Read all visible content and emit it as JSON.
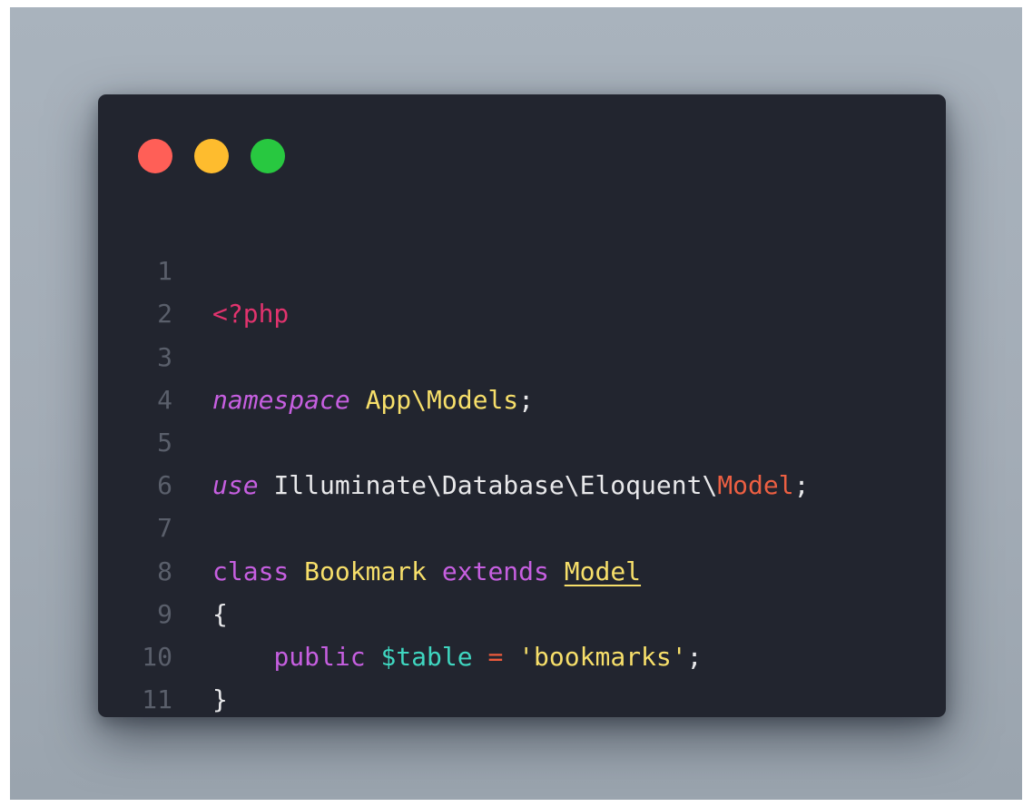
{
  "window": {
    "controls": {
      "close_color": "#ff5f57",
      "minimize_color": "#febc2e",
      "maximize_color": "#28c840"
    }
  },
  "code": {
    "language": "php",
    "lines": [
      {
        "number": "1",
        "tokens": [
          "<?php"
        ]
      },
      {
        "number": "2",
        "tokens": []
      },
      {
        "number": "3",
        "tokens": [
          "namespace",
          " ",
          "App\\Models",
          ";"
        ]
      },
      {
        "number": "4",
        "tokens": []
      },
      {
        "number": "5",
        "tokens": [
          "use",
          " ",
          "Illuminate\\Database\\Eloquent\\",
          "Model",
          ";"
        ]
      },
      {
        "number": "6",
        "tokens": []
      },
      {
        "number": "7",
        "tokens": [
          "class",
          " ",
          "Bookmark",
          " ",
          "extends",
          " ",
          "Model"
        ]
      },
      {
        "number": "8",
        "tokens": [
          "{"
        ]
      },
      {
        "number": "9",
        "tokens": [
          "    ",
          "public",
          " ",
          "$table",
          " ",
          "=",
          " ",
          "'bookmarks'",
          ";"
        ]
      },
      {
        "number": "10",
        "tokens": [
          "}"
        ]
      },
      {
        "number": "11",
        "tokens": []
      }
    ]
  }
}
